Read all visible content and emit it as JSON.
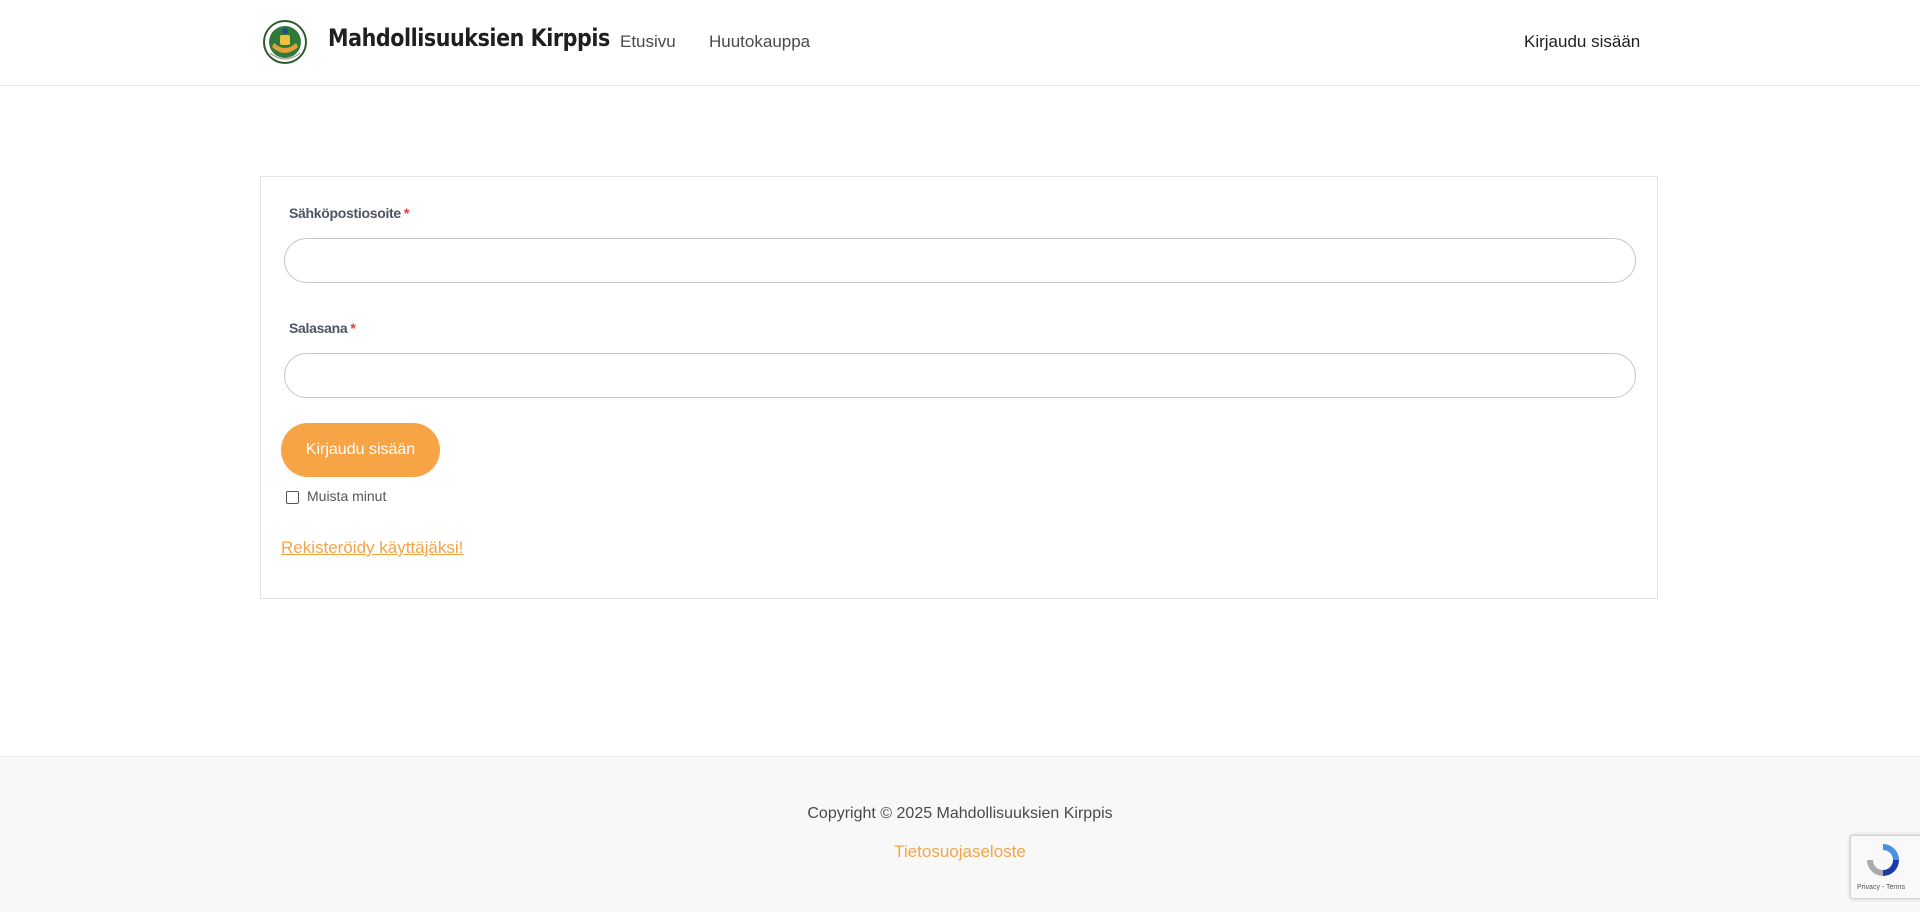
{
  "header": {
    "site_title": "Mahdollisuuksien Kirppis",
    "nav": [
      "Etusivu",
      "Huutokauppa"
    ],
    "login_link": "Kirjaudu sisään"
  },
  "form": {
    "email_label": "Sähköpostiosoite",
    "password_label": "Salasana",
    "required_mark": "*",
    "email_value": "",
    "password_value": "",
    "submit_label": "Kirjaudu sisään",
    "remember_label": "Muista minut",
    "remember_checked": false,
    "register_link": "Rekisteröidy käyttäjäksi!"
  },
  "footer": {
    "copyright": "Copyright © 2025 Mahdollisuuksien Kirppis",
    "privacy_link": "Tietosuojaseloste"
  },
  "recaptcha": {
    "text": "Privacy - Terms"
  },
  "colors": {
    "accent": "#f6a445",
    "required": "#e53935",
    "footer_bg": "#f8f8f8"
  }
}
